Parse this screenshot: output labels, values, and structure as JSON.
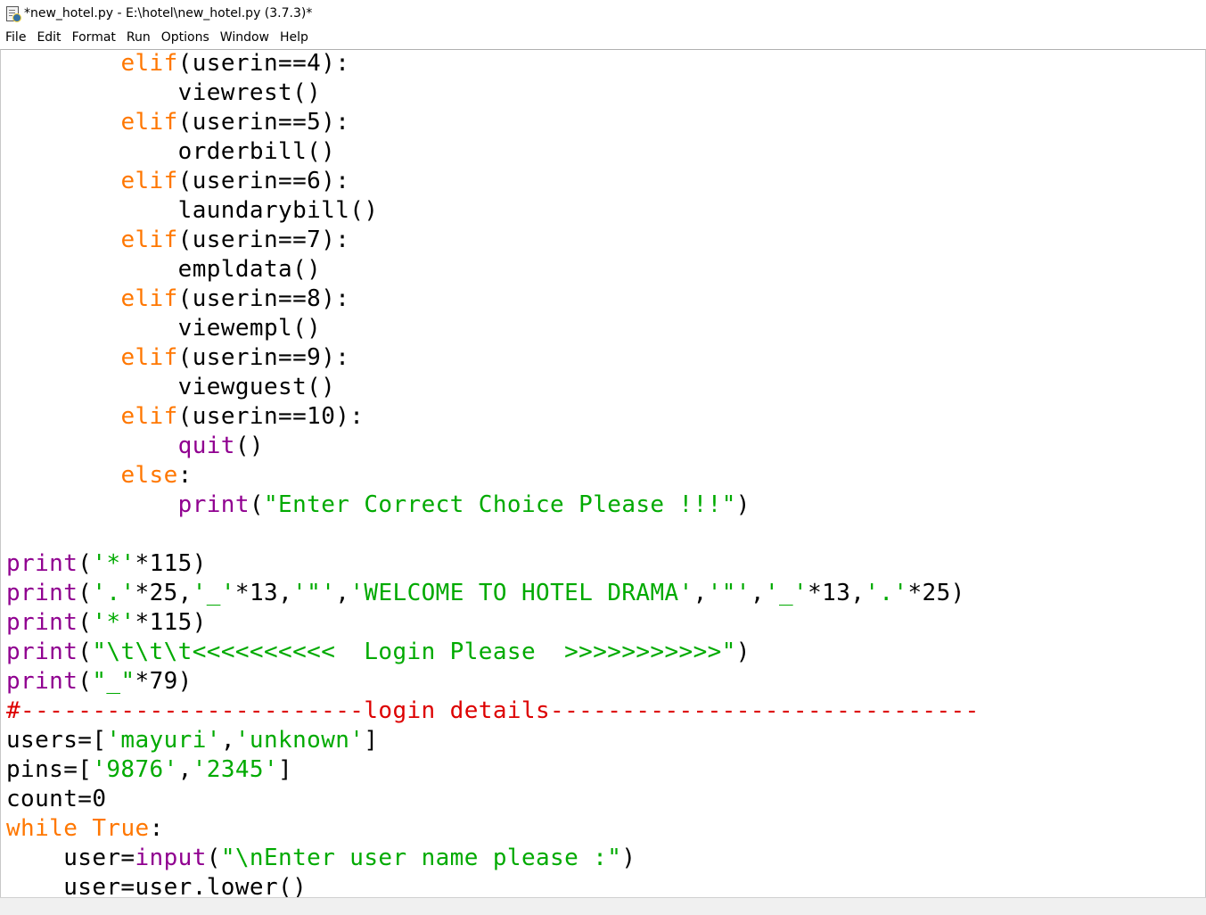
{
  "window": {
    "title": "*new_hotel.py - E:\\hotel\\new_hotel.py (3.7.3)*",
    "icon": "python-file-icon"
  },
  "menu": {
    "items": [
      "File",
      "Edit",
      "Format",
      "Run",
      "Options",
      "Window",
      "Help"
    ]
  },
  "colors": {
    "keyword": "#ff7700",
    "builtin": "#900090",
    "string": "#00aa00",
    "comment": "#dd0000",
    "normal": "#000000"
  },
  "editor": {
    "lines": [
      [
        {
          "t": "        ",
          "k": "normal"
        },
        {
          "t": "elif",
          "k": "keyword"
        },
        {
          "t": "(userin==4):",
          "k": "normal"
        }
      ],
      [
        {
          "t": "            viewrest()",
          "k": "normal"
        }
      ],
      [
        {
          "t": "        ",
          "k": "normal"
        },
        {
          "t": "elif",
          "k": "keyword"
        },
        {
          "t": "(userin==5):",
          "k": "normal"
        }
      ],
      [
        {
          "t": "            orderbill()",
          "k": "normal"
        }
      ],
      [
        {
          "t": "        ",
          "k": "normal"
        },
        {
          "t": "elif",
          "k": "keyword"
        },
        {
          "t": "(userin==6):",
          "k": "normal"
        }
      ],
      [
        {
          "t": "            laundarybill()",
          "k": "normal"
        }
      ],
      [
        {
          "t": "        ",
          "k": "normal"
        },
        {
          "t": "elif",
          "k": "keyword"
        },
        {
          "t": "(userin==7):",
          "k": "normal"
        }
      ],
      [
        {
          "t": "            empldata()",
          "k": "normal"
        }
      ],
      [
        {
          "t": "        ",
          "k": "normal"
        },
        {
          "t": "elif",
          "k": "keyword"
        },
        {
          "t": "(userin==8):",
          "k": "normal"
        }
      ],
      [
        {
          "t": "            viewempl()",
          "k": "normal"
        }
      ],
      [
        {
          "t": "        ",
          "k": "normal"
        },
        {
          "t": "elif",
          "k": "keyword"
        },
        {
          "t": "(userin==9):",
          "k": "normal"
        }
      ],
      [
        {
          "t": "            viewguest()",
          "k": "normal"
        }
      ],
      [
        {
          "t": "        ",
          "k": "normal"
        },
        {
          "t": "elif",
          "k": "keyword"
        },
        {
          "t": "(userin==10):",
          "k": "normal"
        }
      ],
      [
        {
          "t": "            ",
          "k": "normal"
        },
        {
          "t": "quit",
          "k": "builtin"
        },
        {
          "t": "()",
          "k": "normal"
        }
      ],
      [
        {
          "t": "        ",
          "k": "normal"
        },
        {
          "t": "else",
          "k": "keyword"
        },
        {
          "t": ":",
          "k": "normal"
        }
      ],
      [
        {
          "t": "            ",
          "k": "normal"
        },
        {
          "t": "print",
          "k": "builtin"
        },
        {
          "t": "(",
          "k": "normal"
        },
        {
          "t": "\"Enter Correct Choice Please !!!\"",
          "k": "string"
        },
        {
          "t": ")",
          "k": "normal"
        }
      ],
      [
        {
          "t": "",
          "k": "normal"
        }
      ],
      [
        {
          "t": "print",
          "k": "builtin"
        },
        {
          "t": "(",
          "k": "normal"
        },
        {
          "t": "'*'",
          "k": "string"
        },
        {
          "t": "*115)",
          "k": "normal"
        }
      ],
      [
        {
          "t": "print",
          "k": "builtin"
        },
        {
          "t": "(",
          "k": "normal"
        },
        {
          "t": "'.'",
          "k": "string"
        },
        {
          "t": "*25,",
          "k": "normal"
        },
        {
          "t": "'_'",
          "k": "string"
        },
        {
          "t": "*13,",
          "k": "normal"
        },
        {
          "t": "'\"'",
          "k": "string"
        },
        {
          "t": ",",
          "k": "normal"
        },
        {
          "t": "'WELCOME TO HOTEL DRAMA'",
          "k": "string"
        },
        {
          "t": ",",
          "k": "normal"
        },
        {
          "t": "'\"'",
          "k": "string"
        },
        {
          "t": ",",
          "k": "normal"
        },
        {
          "t": "'_'",
          "k": "string"
        },
        {
          "t": "*13,",
          "k": "normal"
        },
        {
          "t": "'.'",
          "k": "string"
        },
        {
          "t": "*25)",
          "k": "normal"
        }
      ],
      [
        {
          "t": "print",
          "k": "builtin"
        },
        {
          "t": "(",
          "k": "normal"
        },
        {
          "t": "'*'",
          "k": "string"
        },
        {
          "t": "*115)",
          "k": "normal"
        }
      ],
      [
        {
          "t": "print",
          "k": "builtin"
        },
        {
          "t": "(",
          "k": "normal"
        },
        {
          "t": "\"\\t\\t\\t<<<<<<<<<<  Login Please  >>>>>>>>>>>\"",
          "k": "string"
        },
        {
          "t": ")",
          "k": "normal"
        }
      ],
      [
        {
          "t": "print",
          "k": "builtin"
        },
        {
          "t": "(",
          "k": "normal"
        },
        {
          "t": "\"_\"",
          "k": "string"
        },
        {
          "t": "*79)",
          "k": "normal"
        }
      ],
      [
        {
          "t": "#------------------------login details------------------------------",
          "k": "comment"
        }
      ],
      [
        {
          "t": "users=[",
          "k": "normal"
        },
        {
          "t": "'mayuri'",
          "k": "string"
        },
        {
          "t": ",",
          "k": "normal"
        },
        {
          "t": "'unknown'",
          "k": "string"
        },
        {
          "t": "]",
          "k": "normal"
        }
      ],
      [
        {
          "t": "pins=[",
          "k": "normal"
        },
        {
          "t": "'9876'",
          "k": "string"
        },
        {
          "t": ",",
          "k": "normal"
        },
        {
          "t": "'2345'",
          "k": "string"
        },
        {
          "t": "]",
          "k": "normal"
        }
      ],
      [
        {
          "t": "count=0",
          "k": "normal"
        }
      ],
      [
        {
          "t": "while",
          "k": "keyword"
        },
        {
          "t": " ",
          "k": "normal"
        },
        {
          "t": "True",
          "k": "keyword"
        },
        {
          "t": ":",
          "k": "normal"
        }
      ],
      [
        {
          "t": "    user=",
          "k": "normal"
        },
        {
          "t": "input",
          "k": "builtin"
        },
        {
          "t": "(",
          "k": "normal"
        },
        {
          "t": "\"\\nEnter user name please :\"",
          "k": "string"
        },
        {
          "t": ")",
          "k": "normal"
        }
      ],
      [
        {
          "t": "    user=user.lower()",
          "k": "normal"
        }
      ]
    ]
  }
}
